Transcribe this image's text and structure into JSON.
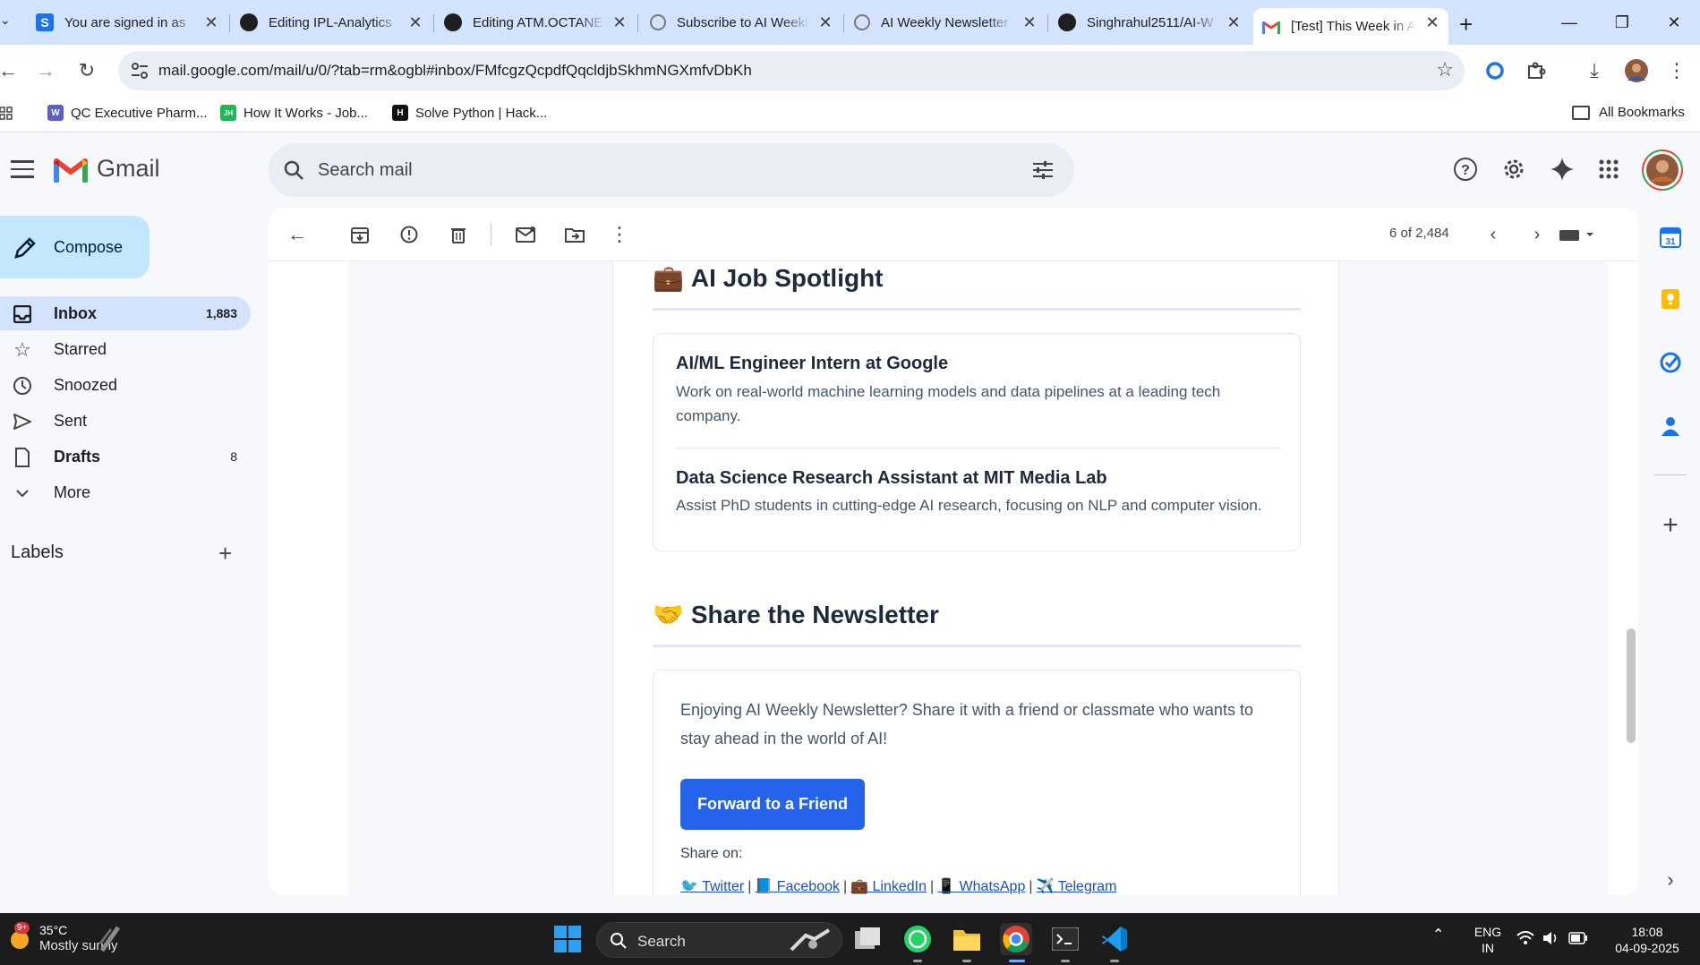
{
  "browser": {
    "tabs": [
      {
        "title": "You are signed in as",
        "icon": "s-icon",
        "active": false
      },
      {
        "title": "Editing IPL-Analytics",
        "icon": "github-icon",
        "active": false
      },
      {
        "title": "Editing ATM.OCTANE",
        "icon": "github-icon",
        "active": false
      },
      {
        "title": "Subscribe to AI Weekly",
        "icon": "globe-icon",
        "active": false
      },
      {
        "title": "AI Weekly Newsletter",
        "icon": "globe-icon",
        "active": false
      },
      {
        "title": "Singhrahul2511/AI-W",
        "icon": "github-icon",
        "active": false
      },
      {
        "title": "[Test] This Week in AI",
        "icon": "gmail-icon",
        "active": true
      }
    ],
    "url": "mail.google.com/mail/u/0/?tab=rm&ogbl#inbox/FMfcgzQcpdfQqcldjbSkhmNGXmfvDbKh",
    "bookmarks": [
      {
        "label": "QC Executive Pharm...",
        "icon_text": "W",
        "color": "#5b5fc7"
      },
      {
        "label": "How It Works - Job...",
        "icon_text": "JH",
        "color": "#1db954"
      },
      {
        "label": "Solve Python | Hack...",
        "icon_text": "H",
        "color": "#111111"
      }
    ],
    "all_bookmarks": "All Bookmarks"
  },
  "gmail": {
    "logo_text": "Gmail",
    "search_placeholder": "Search mail",
    "compose_label": "Compose",
    "nav": [
      {
        "label": "Inbox",
        "count": "1,883",
        "icon": "inbox-icon",
        "active": true,
        "bold": true
      },
      {
        "label": "Starred",
        "count": "",
        "icon": "star-icon",
        "active": false,
        "bold": false
      },
      {
        "label": "Snoozed",
        "count": "",
        "icon": "clock-icon",
        "active": false,
        "bold": false
      },
      {
        "label": "Sent",
        "count": "",
        "icon": "send-icon",
        "active": false,
        "bold": false
      },
      {
        "label": "Drafts",
        "count": "8",
        "icon": "draft-icon",
        "active": false,
        "bold": true
      },
      {
        "label": "More",
        "count": "",
        "icon": "chevron-down-icon",
        "active": false,
        "bold": false
      }
    ],
    "labels_heading": "Labels",
    "message_counter": "6 of 2,484"
  },
  "email": {
    "jobs_section": {
      "emoji": "💼",
      "title": "AI Job Spotlight",
      "jobs": [
        {
          "title": "AI/ML Engineer Intern at Google",
          "desc": "Work on real-world machine learning models and data pipelines at a leading tech company."
        },
        {
          "title": "Data Science Research Assistant at MIT Media Lab",
          "desc": "Assist PhD students in cutting-edge AI research, focusing on NLP and computer vision."
        }
      ]
    },
    "share_section": {
      "emoji": "🤝",
      "title": "Share the Newsletter",
      "text": "Enjoying AI Weekly Newsletter? Share it with a friend or classmate who wants to stay ahead in the world of AI!",
      "button": "Forward to a Friend",
      "share_on": "Share on:",
      "links": [
        {
          "emoji": "🐦",
          "label": " Twitter"
        },
        {
          "emoji": "📘",
          "label": " Facebook"
        },
        {
          "emoji": "💼",
          "label": " LinkedIn"
        },
        {
          "emoji": "📱",
          "label": " WhatsApp"
        },
        {
          "emoji": "✈️",
          "label": " Telegram"
        }
      ]
    }
  },
  "taskbar": {
    "weather_badge": "9+",
    "temperature": "35°C",
    "condition": "Mostly sunny",
    "search_placeholder": "Search",
    "lang_top": "ENG",
    "lang_bottom": "IN",
    "time": "18:08",
    "date": "04-09-2025"
  },
  "colors": {
    "accent_blue": "#2563eb",
    "compose_bg": "#c2e7ff",
    "nav_active_bg": "#d3e3fd"
  }
}
